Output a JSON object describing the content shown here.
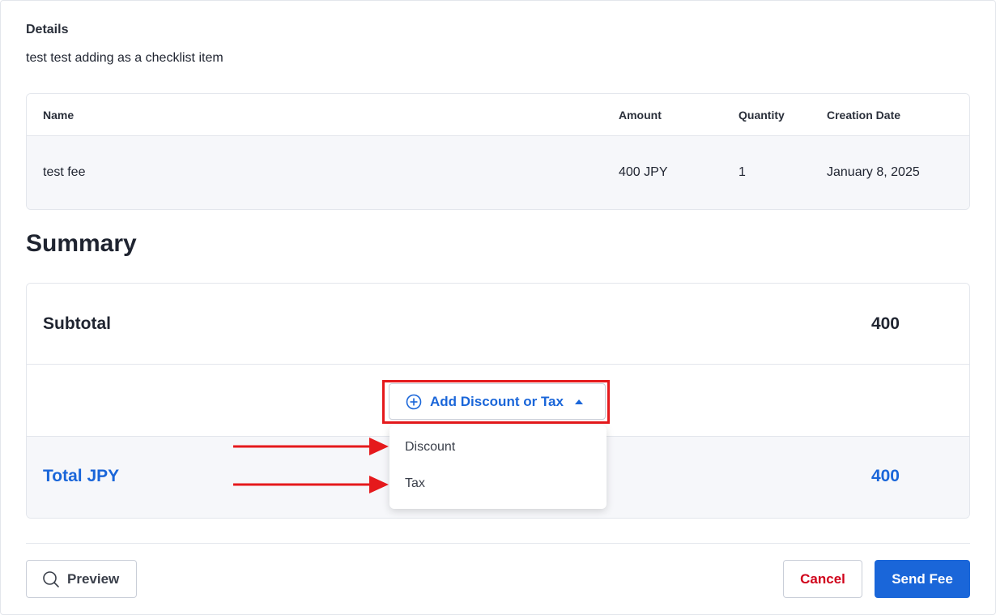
{
  "details": {
    "label": "Details",
    "text": "test test adding as a checklist item"
  },
  "fee_table": {
    "columns": [
      "Name",
      "Amount",
      "Quantity",
      "Creation Date"
    ],
    "rows": [
      {
        "name": "test fee",
        "amount": "400 JPY",
        "quantity": "1",
        "creation_date": "January 8, 2025"
      }
    ]
  },
  "summary": {
    "title": "Summary",
    "subtotal_label": "Subtotal",
    "subtotal_value": "400",
    "add_button_label": "Add Discount or Tax",
    "menu_items": [
      "Discount",
      "Tax"
    ],
    "total_label": "Total JPY",
    "total_value": "400"
  },
  "footer": {
    "preview_label": "Preview",
    "cancel_label": "Cancel",
    "send_label": "Send Fee"
  },
  "colors": {
    "accent": "#1a66d9",
    "danger": "#d0021b",
    "annotation": "#e5191c"
  },
  "icons": {
    "add": "plus-circle-icon",
    "caret": "caret-up-icon",
    "preview": "search-icon"
  }
}
